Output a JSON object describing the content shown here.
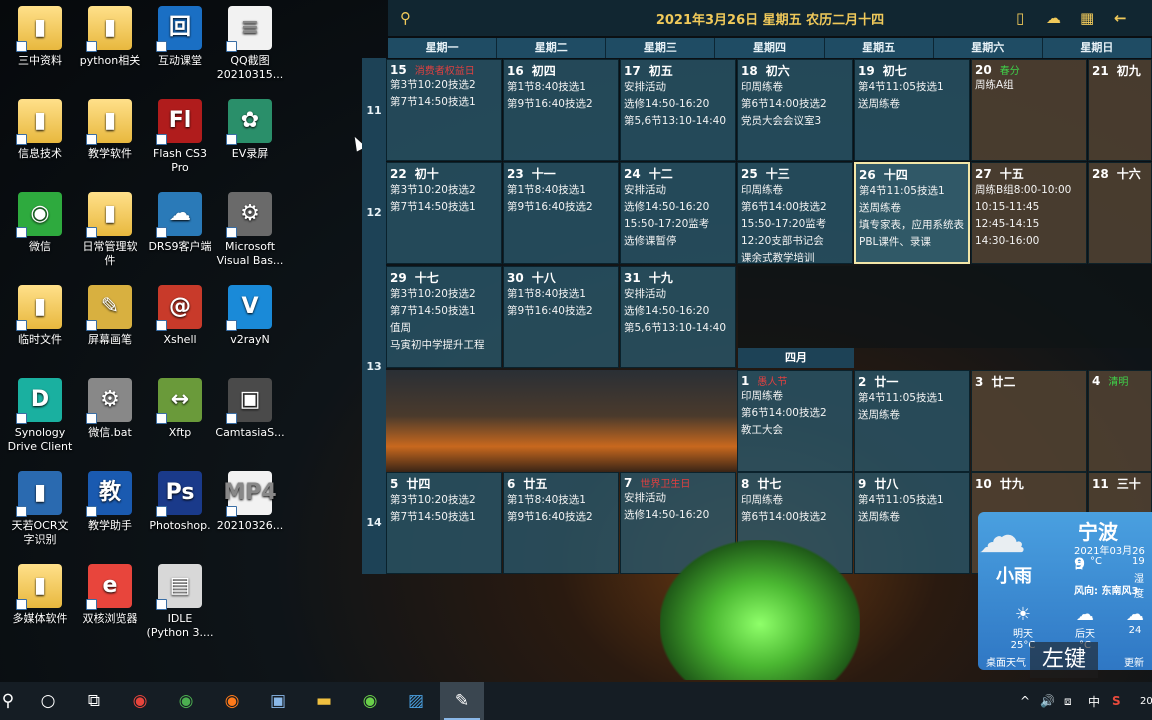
{
  "desktop_icons": [
    {
      "label": "三中资料",
      "glyph": "▮"
    },
    {
      "label": "python相关",
      "glyph": "▮"
    },
    {
      "label": "互动课堂",
      "glyph": "回"
    },
    {
      "label": "QQ截图\n20210315...",
      "glyph": "≡"
    },
    {
      "label": "信息技术",
      "glyph": "▮"
    },
    {
      "label": "教学软件",
      "glyph": "▮"
    },
    {
      "label": "Flash CS3\nPro",
      "glyph": "Fl"
    },
    {
      "label": "EV录屏",
      "glyph": "✿"
    },
    {
      "label": "微信",
      "glyph": "◉"
    },
    {
      "label": "日常管理软\n件",
      "glyph": "▮"
    },
    {
      "label": "DRS9客户端",
      "glyph": "☁"
    },
    {
      "label": "Microsoft\nVisual Bas...",
      "glyph": "⚙"
    },
    {
      "label": "临时文件",
      "glyph": "▮"
    },
    {
      "label": "屏幕画笔",
      "glyph": "✎"
    },
    {
      "label": "Xshell",
      "glyph": "@"
    },
    {
      "label": "v2rayN",
      "glyph": "V"
    },
    {
      "label": "Synology\nDrive Client",
      "glyph": "D"
    },
    {
      "label": "微信.bat",
      "glyph": "⚙"
    },
    {
      "label": "Xftp",
      "glyph": "↔"
    },
    {
      "label": "CamtasiaS...",
      "glyph": "▣"
    },
    {
      "label": "天若OCR文\n字识别",
      "glyph": "▮"
    },
    {
      "label": "教学助手",
      "glyph": "教"
    },
    {
      "label": "Photoshop.",
      "glyph": "Ps"
    },
    {
      "label": "20210326...",
      "glyph": "MP4"
    },
    {
      "label": "多媒体软件",
      "glyph": "▮"
    },
    {
      "label": "双核浏览器",
      "glyph": "e"
    },
    {
      "label": "IDLE\n(Python 3....",
      "glyph": "▤"
    }
  ],
  "calendar": {
    "title": "2021年3月26日 星期五 农历二月十四",
    "weekdays": [
      "星期一",
      "星期二",
      "星期三",
      "星期四",
      "星期五",
      "星期六",
      "星期日"
    ],
    "week_numbers": [
      "11",
      "12",
      "13",
      "14"
    ],
    "month_label": "四月",
    "cells": [
      {
        "day": "15",
        "lunar": "消费者权益日",
        "lunar_color": "red",
        "events": [
          "第3节10:20技选2",
          "第7节14:50技选1"
        ]
      },
      {
        "day": "16",
        "lunar": "初四",
        "events": [
          "第1节8:40技选1",
          "第9节16:40技选2"
        ]
      },
      {
        "day": "17",
        "lunar": "初五",
        "events": [
          "安排活动",
          "选修14:50-16:20",
          "第5,6节13:10-14:40"
        ]
      },
      {
        "day": "18",
        "lunar": "初六",
        "events": [
          "印周练卷",
          "第6节14:00技选2",
          "党员大会会议室3"
        ]
      },
      {
        "day": "19",
        "lunar": "初七",
        "events": [
          "第4节11:05技选1",
          "送周练卷"
        ]
      },
      {
        "day": "20",
        "lunar": "春分",
        "lunar_color": "green",
        "events": [
          "周练A组"
        ]
      },
      {
        "day": "21",
        "lunar": "初九",
        "events": []
      },
      {
        "day": "22",
        "lunar": "初十",
        "events": [
          "第3节10:20技选2",
          "第7节14:50技选1"
        ]
      },
      {
        "day": "23",
        "lunar": "十一",
        "events": [
          "第1节8:40技选1",
          "第9节16:40技选2"
        ]
      },
      {
        "day": "24",
        "lunar": "十二",
        "events": [
          "安排活动",
          "选修14:50-16:20",
          "15:50-17:20监考",
          "选修课暂停"
        ]
      },
      {
        "day": "25",
        "lunar": "十三",
        "events": [
          "印周练卷",
          "第6节14:00技选2",
          "15:50-17:20监考",
          "12:20支部书记会",
          "课余式教学培训"
        ]
      },
      {
        "day": "26",
        "lunar": "十四",
        "events": [
          "第4节11:05技选1",
          "送周练卷",
          "填专家表，应用系统表",
          "PBL课件、录课"
        ]
      },
      {
        "day": "27",
        "lunar": "十五",
        "events": [
          "周练B组8:00-10:00",
          "10:15-11:45",
          "12:45-14:15",
          "14:30-16:00"
        ]
      },
      {
        "day": "28",
        "lunar": "十六",
        "events": []
      },
      {
        "day": "29",
        "lunar": "十七",
        "events": [
          "第3节10:20技选2",
          "第7节14:50技选1",
          "值周",
          "马寅初中学提升工程"
        ]
      },
      {
        "day": "30",
        "lunar": "十八",
        "events": [
          "第1节8:40技选1",
          "第9节16:40技选2"
        ]
      },
      {
        "day": "31",
        "lunar": "十九",
        "events": [
          "安排活动",
          "选修14:50-16:20",
          "第5,6节13:10-14:40"
        ]
      },
      {
        "day": "1",
        "lunar": "愚人节",
        "lunar_color": "red",
        "events": [
          "印周练卷",
          "第6节14:00技选2",
          "教工大会"
        ]
      },
      {
        "day": "2",
        "lunar": "廿一",
        "events": [
          "第4节11:05技选1",
          "送周练卷"
        ]
      },
      {
        "day": "3",
        "lunar": "廿二",
        "events": []
      },
      {
        "day": "4",
        "lunar": "清明",
        "lunar_color": "green",
        "events": []
      },
      {
        "day": "5",
        "lunar": "廿四",
        "events": [
          "第3节10:20技选2",
          "第7节14:50技选1"
        ]
      },
      {
        "day": "6",
        "lunar": "廿五",
        "events": [
          "第1节8:40技选1",
          "第9节16:40技选2"
        ]
      },
      {
        "day": "7",
        "lunar": "世界卫生日",
        "lunar_color": "red",
        "events": [
          "安排活动",
          "选修14:50-16:20"
        ]
      },
      {
        "day": "8",
        "lunar": "廿七",
        "events": [
          "印周练卷",
          "第6节14:00技选2"
        ]
      },
      {
        "day": "9",
        "lunar": "廿八",
        "events": [
          "第4节11:05技选1",
          "送周练卷"
        ]
      },
      {
        "day": "10",
        "lunar": "廿九",
        "events": []
      },
      {
        "day": "11",
        "lunar": "三十",
        "events": []
      }
    ]
  },
  "weather": {
    "city": "宁波",
    "date": "2021年03月26日",
    "condition": "小雨",
    "temp": "9",
    "temp_unit": "°C",
    "temp_range": "19",
    "humidity": "湿度",
    "wind": "风向: 东南风3",
    "forecast": [
      {
        "day": "明天",
        "temp": "25°C"
      },
      {
        "day": "后天",
        "temp": "°C"
      },
      {
        "day": "",
        "temp": "24"
      }
    ],
    "footer": "桌面天气",
    "more": "更新"
  },
  "overlay_key": "左键",
  "taskbar": {
    "tray": [
      "^",
      "中(|))",
      "中",
      "S"
    ],
    "time": "20"
  }
}
